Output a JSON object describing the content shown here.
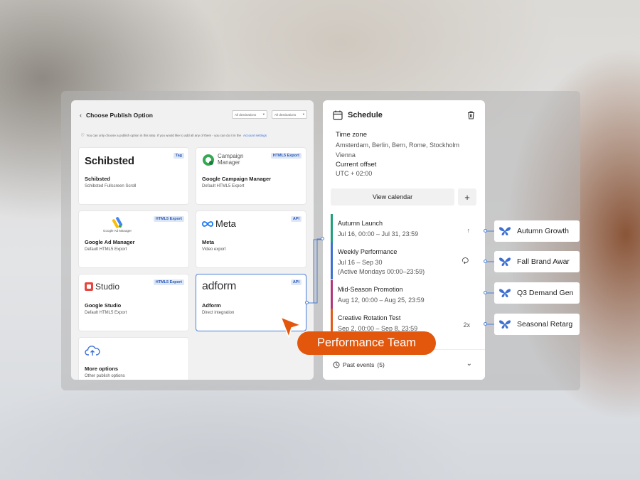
{
  "left_panel": {
    "title": "Choose Publish Option",
    "back_label": "‹",
    "selects": [
      {
        "value": "All destinations"
      },
      {
        "value": "All destinations"
      }
    ],
    "info_text": "You can only choose a publish option in this step. If you would like to add all any of them - you can do it in the",
    "info_link": "Account settings",
    "cards": [
      {
        "logo": "Schibsted",
        "badge": "Tag",
        "name": "Schibsted",
        "desc": "Schibsted Fullscreen Scroll"
      },
      {
        "logo": "Campaign Manager",
        "badge": "HTML5 Export",
        "name": "Google Campaign Manager",
        "desc": "Default HTML5 Export"
      },
      {
        "logo": "Google Ad Manager",
        "badge": "HTML5 Export",
        "name": "Google Ad Manager",
        "desc": "Default HTML5 Export"
      },
      {
        "logo": "Meta",
        "badge": "API",
        "name": "Meta",
        "desc": "Video export"
      },
      {
        "logo": "Studio",
        "badge": "HTML5 Export",
        "name": "Google Studio",
        "desc": "Default HTML5 Export"
      },
      {
        "logo": "adform",
        "badge": "API",
        "name": "Adform",
        "desc": "Direct integration"
      },
      {
        "logo": "cloud-upload-icon",
        "badge": "",
        "name": "More options",
        "desc": "Other publish options"
      }
    ]
  },
  "schedule": {
    "title": "Schedule",
    "timezone_label": "Time zone",
    "timezone_value": "Amsterdam, Berlin, Bern, Rome, Stockholm Vienna",
    "offset_label": "Current offset",
    "offset_value": "UTC + 02:00",
    "view_calendar_label": "View calendar",
    "add_label": "+",
    "events": [
      {
        "name": "Autumn Launch",
        "dates": "Jul 16, 00:00 – Jul 31, 23:59",
        "extra": "",
        "icon": "arrow-up-icon",
        "icon_text": "↑",
        "color": "#1f9e7a"
      },
      {
        "name": "Weekly Performance",
        "dates": "Jul 16 – Sep 30",
        "extra": "(Active Mondays 00:00–23:59)",
        "icon": "repeat-icon",
        "icon_text": "",
        "color": "#3d6fd1"
      },
      {
        "name": "Mid-Season Promotion",
        "dates": "Aug 12, 00:00 – Aug 25, 23:59",
        "extra": "",
        "icon": "",
        "icon_text": "",
        "color": "#b0367a"
      },
      {
        "name": "Creative Rotation Test",
        "dates": "Sep 2, 00:00 – Sep 8, 23:59",
        "extra": "",
        "icon": "",
        "icon_text": "2x",
        "color": "#e25a16"
      }
    ],
    "past_events_label": "Past events",
    "past_events_count": "(5)"
  },
  "campaigns": [
    {
      "name": "Autumn Growth"
    },
    {
      "name": "Fall Brand Awar"
    },
    {
      "name": "Q3 Demand Gen"
    },
    {
      "name": "Seasonal Retarg"
    }
  ],
  "team_label": "Performance Team",
  "colors": {
    "accent_orange": "#e2570c",
    "accent_blue": "#4a7fd6",
    "badge_bg": "#dde7f7"
  }
}
